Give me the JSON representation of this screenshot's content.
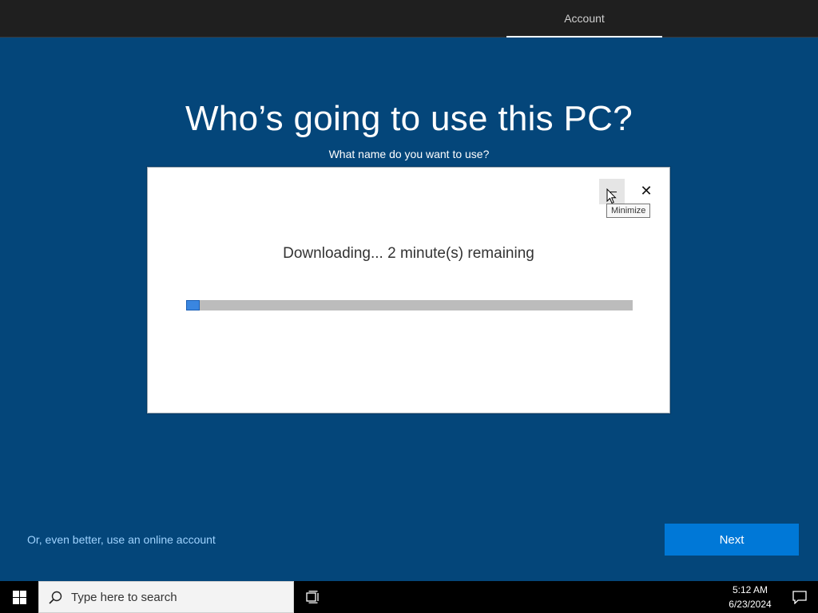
{
  "header": {
    "active_tab": "Account"
  },
  "main": {
    "title": "Who’s going to use this PC?",
    "subtitle": "What name do you want to use?"
  },
  "dialog": {
    "status": "Downloading... 2 minute(s) remaining",
    "tooltip": "Minimize",
    "progress_fraction": 0.03,
    "buttons": {
      "minimize_icon": "minimize-icon",
      "close_icon": "close-icon"
    }
  },
  "actions": {
    "online_account_link": "Or, even better, use an online account",
    "next_label": "Next"
  },
  "taskbar": {
    "search_placeholder": "Type here to search",
    "time": "5:12 AM",
    "date": "6/23/2024"
  },
  "colors": {
    "background": "#04467a",
    "accent": "#0078d7",
    "link": "#9fd3ff",
    "progress_fill": "#3a86e0",
    "progress_track": "#bcbcbc"
  }
}
